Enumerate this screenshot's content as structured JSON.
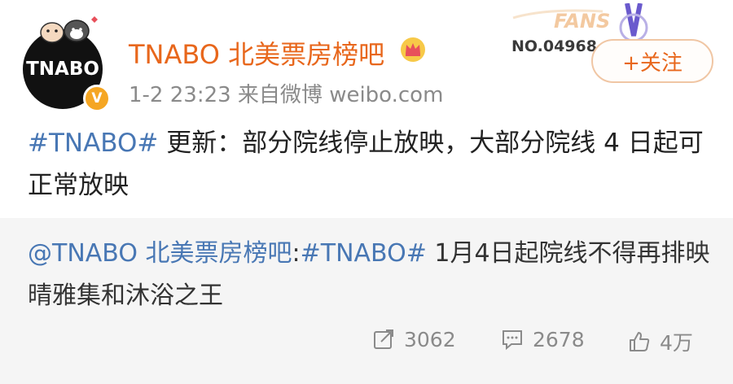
{
  "header": {
    "avatar_text": "TNABO",
    "verify_badge": "V",
    "username": "TNABO 北美票房榜吧",
    "meta": "1-2 23:23  来自微博 weibo.com",
    "fans_badge": {
      "word": "FANS",
      "number": "NO.04968"
    },
    "follow_button": "+关注"
  },
  "post": {
    "hashtag": "#TNABO#",
    "text": " 更新：部分院线停止放映，大部分院线 4 日起可正常放映"
  },
  "repost": {
    "mention": "@TNABO 北美票房榜吧",
    "colon": ":",
    "hashtag": "#TNABO#",
    "text": " 1月4日起院线不得再排映晴雅集和沐浴之王"
  },
  "actions": {
    "share_count": "3062",
    "comment_count": "2678",
    "like_count": "4万"
  },
  "colors": {
    "username": "#e8671c",
    "link": "#4877b4",
    "repost_bg": "#f5f5f5",
    "meta_gray": "#8a8a8a"
  },
  "icons": [
    "crown-icon",
    "verified-icon",
    "share-icon",
    "comment-icon",
    "like-icon"
  ]
}
